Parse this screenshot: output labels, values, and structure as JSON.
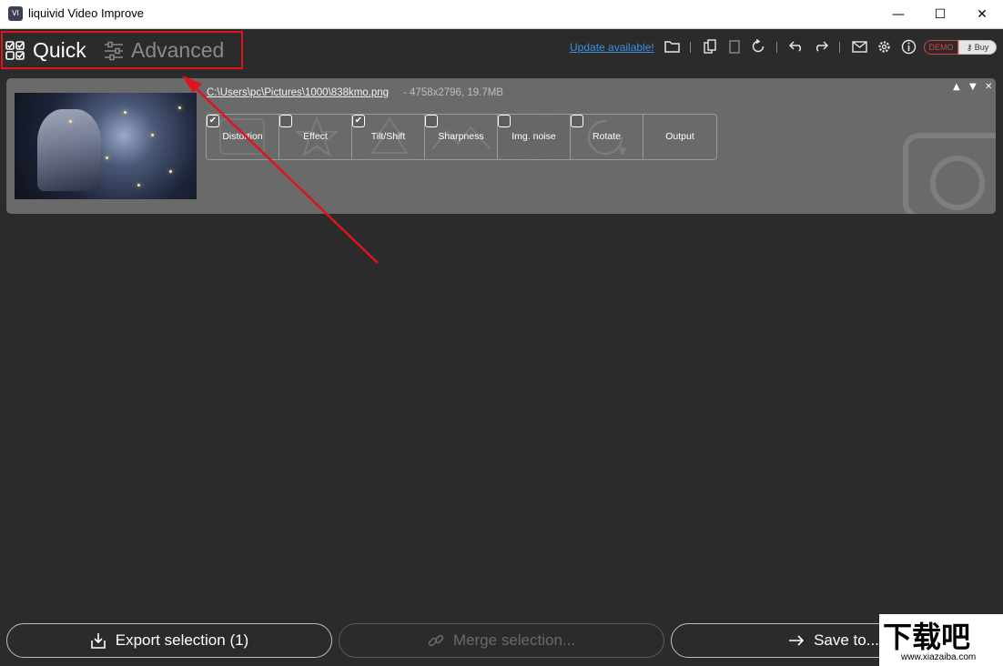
{
  "window": {
    "title": "liquivid Video Improve",
    "logo_text": "VI",
    "minimize_glyph": "—",
    "maximize_glyph": "☐",
    "close_glyph": "✕"
  },
  "modes": {
    "quick_label": "Quick",
    "advanced_label": "Advanced",
    "active": "Quick"
  },
  "toolbar": {
    "update_link": "Update available!",
    "icons": [
      "folder-icon",
      "copy-icon",
      "paste-icon",
      "reset-icon",
      "undo-icon",
      "redo-icon",
      "mail-icon",
      "settings-icon",
      "info-icon"
    ],
    "demo_label": "DEMO",
    "buy_label": "Buy"
  },
  "file": {
    "path": "C:\\Users\\pc\\Pictures\\1000\\838kmo.png",
    "meta": "-   4758x2796, 19.7MB",
    "options": [
      {
        "label": "Distortion",
        "checked": true
      },
      {
        "label": "Effect",
        "checked": false
      },
      {
        "label": "Tilt/Shift",
        "checked": true
      },
      {
        "label": "Sharpness",
        "checked": false
      },
      {
        "label": "Img. noise",
        "checked": false
      },
      {
        "label": "Rotate",
        "checked": false
      },
      {
        "label": "Output",
        "checked": null
      }
    ]
  },
  "bottom": {
    "export_label": "Export selection (1)",
    "merge_label": "Merge selection...",
    "save_label": "Save to..."
  },
  "watermark": {
    "big": "下载吧",
    "small": "www.xiazaiba.com"
  },
  "colors": {
    "highlight": "#e0141c",
    "link": "#3d8fe0",
    "background": "#2b2b2b",
    "card": "#6a6a6a"
  }
}
